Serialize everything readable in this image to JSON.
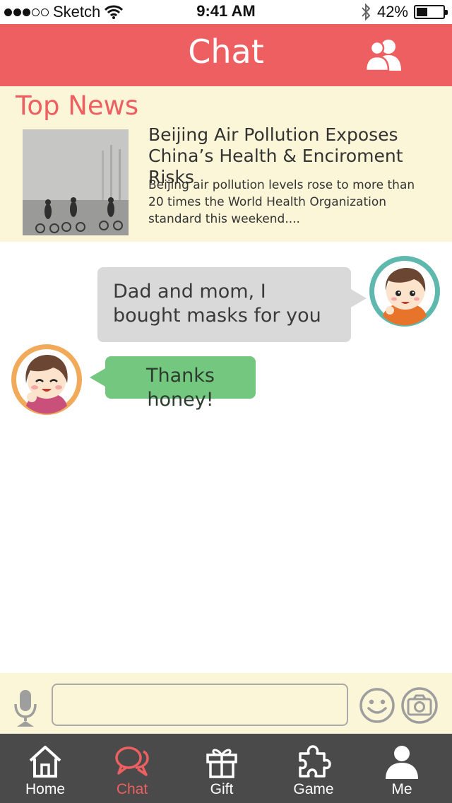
{
  "status_bar": {
    "carrier": "Sketch",
    "time": "9:41 AM",
    "battery": "42%",
    "battery_level": 0.42
  },
  "header": {
    "title": "Chat"
  },
  "news": {
    "heading": "Top News",
    "title_line1": "Beijing Air Pollution Exposes",
    "title_line2": "China’s Health & Enciroment Risks",
    "summary": "Beijing air pollution levels rose to more than 20 times the World Health Organization standard this weekend...."
  },
  "messages": [
    {
      "sender": "me",
      "text": "Dad and mom, I bought masks for you"
    },
    {
      "sender": "mom",
      "text": "Thanks honey!"
    }
  ],
  "input": {
    "value": "",
    "placeholder": ""
  },
  "tabs": [
    {
      "label": "Home",
      "icon": "home-icon"
    },
    {
      "label": "Chat",
      "icon": "chat-icon",
      "active": true
    },
    {
      "label": "Gift",
      "icon": "gift-icon"
    },
    {
      "label": "Game",
      "icon": "puzzle-icon"
    },
    {
      "label": "Me",
      "icon": "person-icon"
    }
  ],
  "colors": {
    "accent": "#ee5f61",
    "news_background": "#fbf6d8",
    "outgoing_bubble": "#d9d9d9",
    "incoming_bubble": "#74c77f",
    "tab_bar": "#4a4a4a"
  }
}
